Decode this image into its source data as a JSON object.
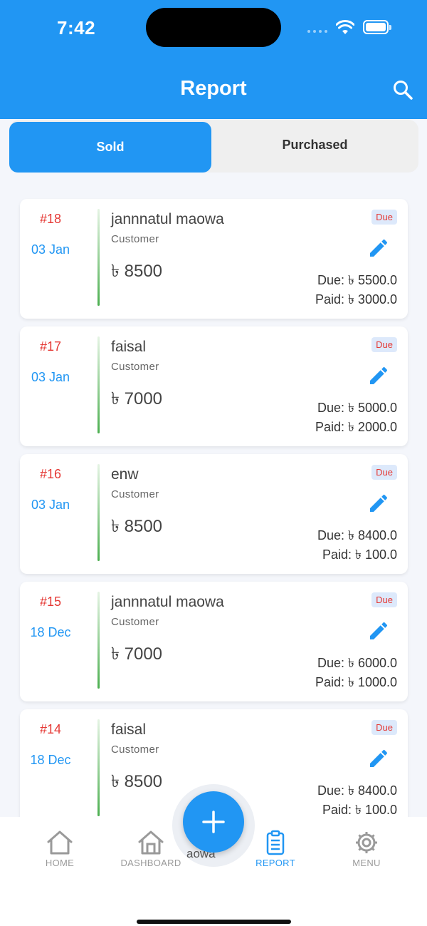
{
  "status_bar": {
    "time": "7:42"
  },
  "header": {
    "title": "Report"
  },
  "tabs": [
    {
      "label": "Sold"
    },
    {
      "label": "Purchased"
    }
  ],
  "records": [
    {
      "number": "#18",
      "date": "03 Jan",
      "name": "jannnatul  maowa",
      "type": "Customer",
      "amount": "৳ 8500",
      "status": "Due",
      "due": "Due: ৳ 5500.0",
      "paid": "Paid: ৳ 3000.0"
    },
    {
      "number": "#17",
      "date": "03 Jan",
      "name": "faisal",
      "type": "Customer",
      "amount": "৳ 7000",
      "status": "Due",
      "due": "Due: ৳ 5000.0",
      "paid": "Paid: ৳ 2000.0"
    },
    {
      "number": "#16",
      "date": "03 Jan",
      "name": "enw",
      "type": "Customer",
      "amount": "৳ 8500",
      "status": "Due",
      "due": "Due: ৳ 8400.0",
      "paid": "Paid: ৳ 100.0"
    },
    {
      "number": "#15",
      "date": "18 Dec",
      "name": "jannnatul  maowa",
      "type": "Customer",
      "amount": "৳ 7000",
      "status": "Due",
      "due": "Due: ৳ 6000.0",
      "paid": "Paid: ৳ 1000.0"
    },
    {
      "number": "#14",
      "date": "18 Dec",
      "name": "faisal",
      "type": "Customer",
      "amount": "৳ 8500",
      "status": "Due",
      "due": "Due: ৳ 8400.0",
      "paid": "Paid: ৳ 100.0"
    }
  ],
  "bottom_nav": {
    "items": [
      {
        "label": "HOME",
        "icon": "home-icon"
      },
      {
        "label": "DASHBOARD",
        "icon": "dashboard-icon"
      },
      {
        "label": "REPORT",
        "icon": "clipboard-icon"
      },
      {
        "label": "MENU",
        "icon": "gear-icon"
      }
    ],
    "peek_text": "aowa"
  },
  "colors": {
    "primary": "#2196f3",
    "accent_red": "#e53935",
    "bar_green": "#4caf50"
  }
}
